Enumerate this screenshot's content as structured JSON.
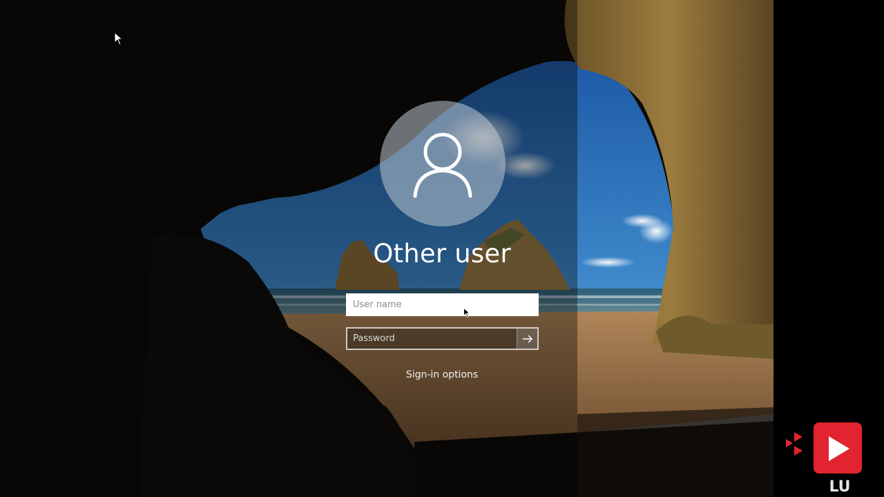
{
  "login": {
    "username_title": "Other user",
    "username_placeholder": "User name",
    "password_placeholder": "Password",
    "signin_options_label": "Sign-in options"
  },
  "icons": {
    "avatar": "user-silhouette-icon",
    "submit": "arrow-right-icon",
    "cursor": "mouse-pointer-icon",
    "watermark": "play-logo-icon"
  },
  "colors": {
    "text": "#ffffff",
    "avatar_circle": "#b4bec8",
    "field_border": "#ffffff",
    "watermark_red": "#e1242f"
  }
}
